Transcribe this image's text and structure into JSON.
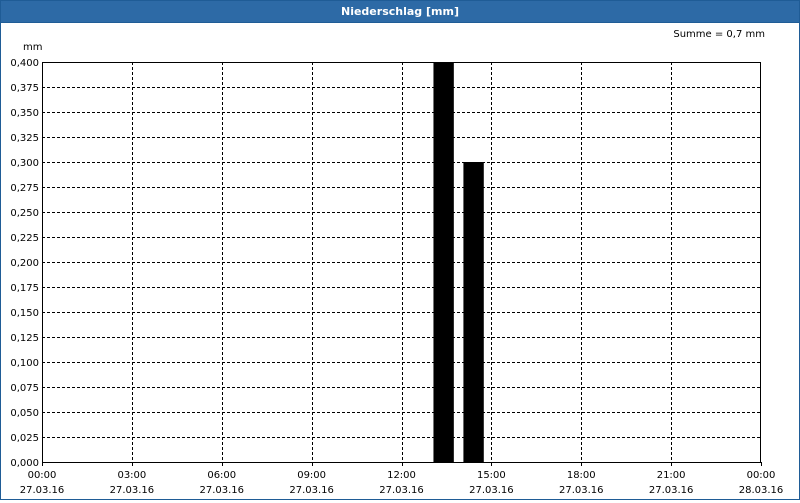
{
  "window": {
    "title": "Niederschlag [mm]"
  },
  "summary": "Summe = 0,7 mm",
  "chart_data": {
    "type": "bar",
    "title": "Niederschlag [mm]",
    "ylabel": "mm",
    "xlabel": "",
    "ylim": [
      0,
      0.4
    ],
    "yticks": [
      0,
      0.025,
      0.05,
      0.075,
      0.1,
      0.125,
      0.15,
      0.175,
      0.2,
      0.225,
      0.25,
      0.275,
      0.3,
      0.325,
      0.35,
      0.375,
      0.4
    ],
    "ytick_labels": [
      "0,000",
      "0,025",
      "0,050",
      "0,075",
      "0,100",
      "0,125",
      "0,150",
      "0,175",
      "0,200",
      "0,225",
      "0,250",
      "0,275",
      "0,300",
      "0,325",
      "0,350",
      "0,375",
      "0,400"
    ],
    "x_range_hours": [
      0,
      24
    ],
    "xticks_hours": [
      0,
      3,
      6,
      9,
      12,
      15,
      18,
      21,
      24
    ],
    "xtick_labels": [
      [
        "00:00",
        "27.03.16"
      ],
      [
        "03:00",
        "27.03.16"
      ],
      [
        "06:00",
        "27.03.16"
      ],
      [
        "09:00",
        "27.03.16"
      ],
      [
        "12:00",
        "27.03.16"
      ],
      [
        "15:00",
        "27.03.16"
      ],
      [
        "18:00",
        "27.03.16"
      ],
      [
        "21:00",
        "27.03.16"
      ],
      [
        "00:00",
        "28.03.16"
      ]
    ],
    "bar_color": "#000000",
    "grid": true,
    "bars": [
      {
        "hour": 13,
        "value": 0.4
      },
      {
        "hour": 14,
        "value": 0.3
      }
    ]
  }
}
